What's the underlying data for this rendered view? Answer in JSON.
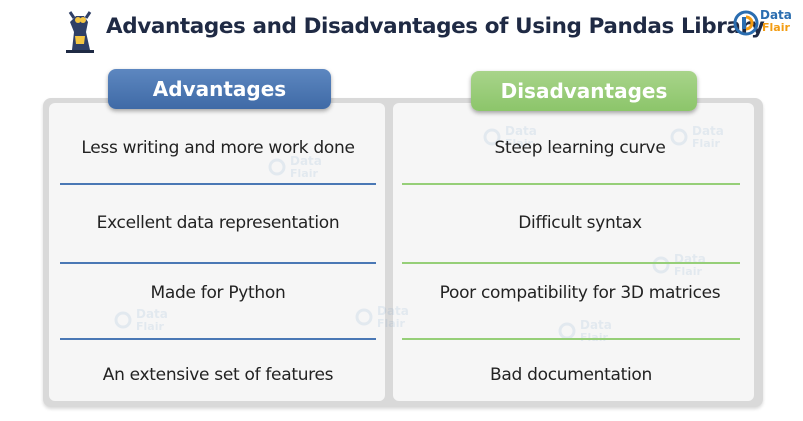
{
  "header": {
    "title": "Advantages and Disadvantages of Using Pandas Library",
    "logo_line1": "Data",
    "logo_line2": "Flair"
  },
  "advantages": {
    "heading": "Advantages",
    "color": "#4a74b0",
    "items": [
      "Less writing and more work done",
      "Excellent data representation",
      "Made for Python",
      "An extensive set of features"
    ]
  },
  "disadvantages": {
    "heading": "Disadvantages",
    "color": "#9ccc7c",
    "items": [
      "Steep learning curve",
      "Difficult syntax",
      "Poor compatibility for 3D matrices",
      "Bad documentation"
    ]
  },
  "watermark": {
    "line1": "Data",
    "line2": "Flair"
  }
}
